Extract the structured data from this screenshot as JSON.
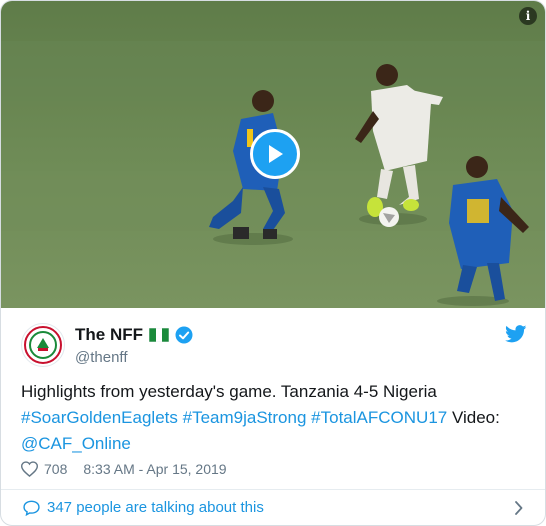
{
  "video": {
    "thumbnail": "football-match-players",
    "play_icon": "play-icon",
    "info_icon": "info-icon",
    "info_label": "i"
  },
  "author": {
    "name": "The NFF",
    "flag": "nigeria-flag",
    "verified_icon": "verified-badge-icon",
    "handle": "@thenff",
    "avatar": "nff-logo"
  },
  "tweet": {
    "text_plain": "Highlights from yesterday's game. Tanzania 4-5 Nigeria",
    "hashtag_1": "#SoarGoldenEaglets",
    "hashtag_2": "#Team9jaStrong",
    "hashtag_3": "#TotalAFCONU17",
    "video_credit": "Video:",
    "mention": "@CAF_Online"
  },
  "meta": {
    "likes": "708",
    "timestamp": "8:33 AM - Apr 15, 2019"
  },
  "footer": {
    "talking": "347 people are talking about this"
  },
  "colors": {
    "link": "#1b95e0",
    "twitter_blue": "#1da1f2",
    "pitch": "#6d8a56",
    "secondary_text": "#657786"
  }
}
